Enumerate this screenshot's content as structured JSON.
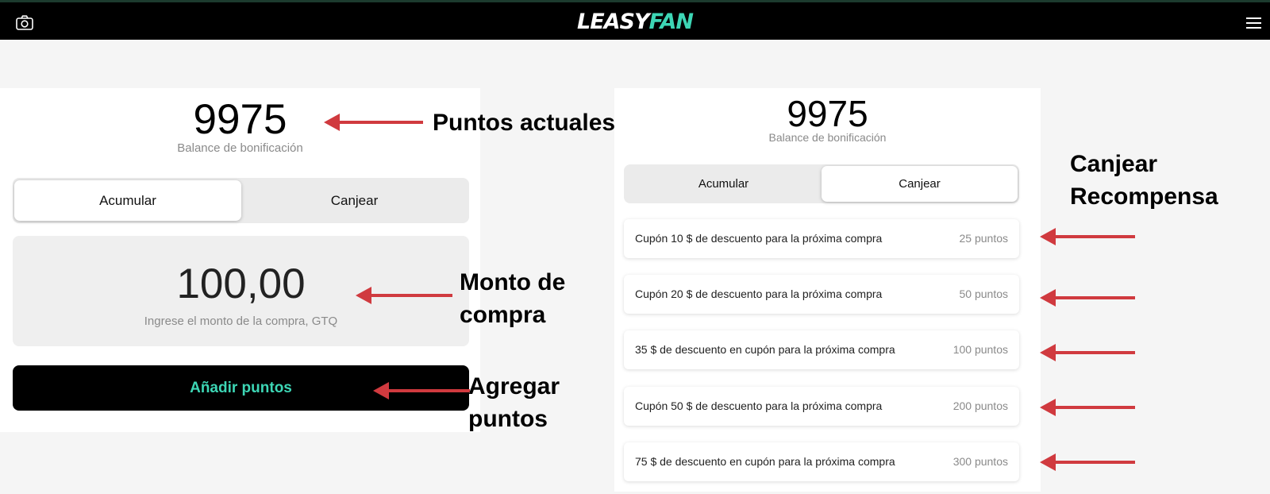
{
  "app": {
    "logo_part1": "LEASY",
    "logo_part2": "FAN"
  },
  "accumulate_view": {
    "points": "9975",
    "balance_label": "Balance de bonificación",
    "tabs": [
      "Acumular",
      "Canjear"
    ],
    "active_tab": "Acumular",
    "amount_value": "100,00",
    "amount_placeholder": "Ingrese el monto de la compra, GTQ",
    "add_button_label": "Añadir puntos"
  },
  "redeem_view": {
    "points": "9975",
    "balance_label": "Balance de bonificación",
    "tabs": [
      "Acumular",
      "Canjear"
    ],
    "active_tab": "Canjear",
    "rewards": [
      {
        "label": "Cupón 10 $ de descuento para la próxima compra",
        "points": "25 puntos"
      },
      {
        "label": "Cupón 20 $ de descuento para la próxima compra",
        "points": "50 puntos"
      },
      {
        "label": "35 $ de descuento en cupón para la próxima compra",
        "points": "100 puntos"
      },
      {
        "label": "Cupón 50 $ de descuento para la próxima compra",
        "points": "200 puntos"
      },
      {
        "label": "75 $ de descuento en cupón para la próxima compra",
        "points": "300 puntos"
      }
    ]
  },
  "annotations": {
    "current_points_line1": "Puntos actuales",
    "purchase_amount_line1": "Monto de",
    "purchase_amount_line2": "compra",
    "add_points_line1": "Agregar",
    "add_points_line2": "puntos",
    "redeem_line1": "Canjear",
    "redeem_line2": "Recompensa"
  },
  "colors": {
    "brand_accent": "#3dd6b5",
    "annotation_arrow": "#d03a3f",
    "top_bar": "#000000"
  },
  "icons": [
    "camera-icon",
    "hamburger-menu-icon"
  ]
}
